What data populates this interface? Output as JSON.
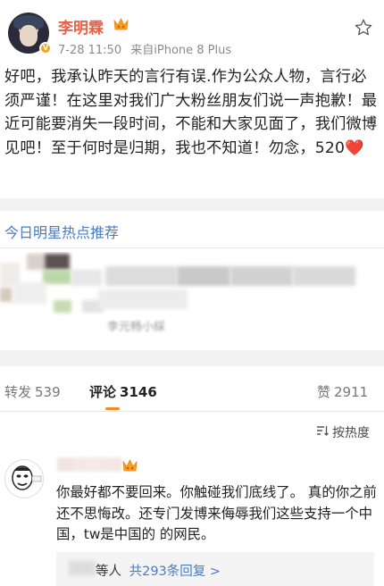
{
  "post": {
    "username": "李明霖",
    "time": "7-28 11:50",
    "source": "来自iPhone 8 Plus",
    "text": "好吧，我承认昨天的言行有误.作为公众人物，言行必须严谨！在这里对我们广大粉丝朋友们说一声抱歉！最近可能要消失一段时间，不能和大家见面了，我们微博见吧！至于何时是归期，我也不知道！勿念，520",
    "heart": "❤️"
  },
  "hot": {
    "title": "今日明星热点推荐",
    "blurred_caption": "李元畅小綵"
  },
  "tabs": {
    "repost_label": "转发",
    "repost_count": "539",
    "comment_label": "评论",
    "comment_count": "3146",
    "like_label": "赞",
    "like_count": "2911"
  },
  "sort": {
    "label": "按热度"
  },
  "comment": {
    "text": "你最好都不要回来。你触碰我们底线了。 真的你之前还不思悔改。还专门发博来侮辱我们这些支持一个中国，tw是中国的 的网民。",
    "reply_prefix": "等人",
    "reply_link": "共293条回复 >"
  },
  "colors": {
    "username": "#e8624a",
    "link": "#4a7bbd",
    "accent": "#f4891e"
  }
}
